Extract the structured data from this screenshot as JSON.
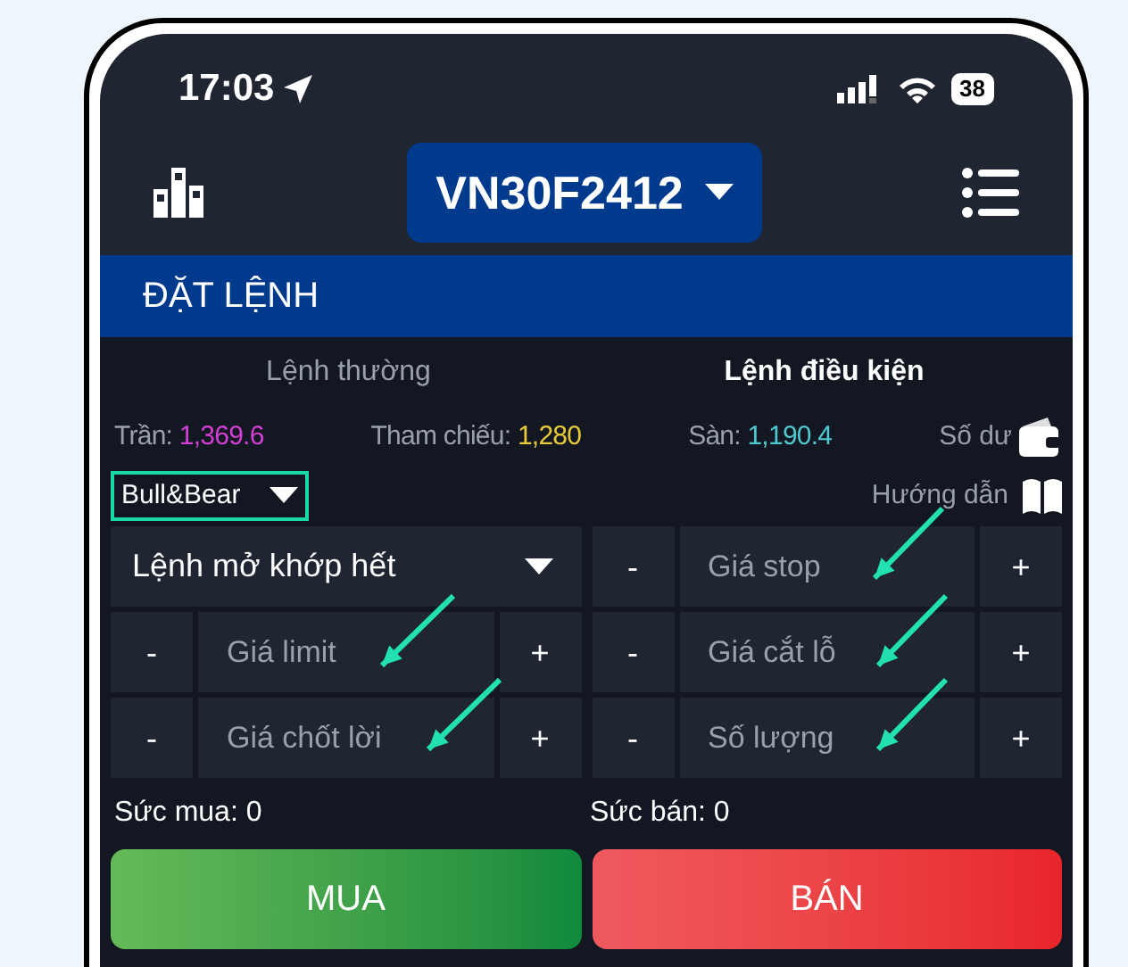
{
  "status_bar": {
    "time": "17:03",
    "battery": "38"
  },
  "header": {
    "symbol": "VN30F2412"
  },
  "title": "ĐẶT LỆNH",
  "tabs": [
    {
      "label": "Lệnh thường",
      "selected": false
    },
    {
      "label": "Lệnh điều kiện",
      "selected": true
    }
  ],
  "prices": [
    {
      "label": "Trần:",
      "value": "1,369.6",
      "color": "#d63fd6"
    },
    {
      "label": "Tham chiếu:",
      "value": "1,280",
      "color": "#e8c93a"
    },
    {
      "label": "Sàn:",
      "value": "1,190.4",
      "color": "#4fc9d0"
    }
  ],
  "balance_label": "Số dư",
  "strategy": {
    "value": "Bull&Bear"
  },
  "guide_label": "Hướng dẫn",
  "order_type": {
    "value": "Lệnh mở khớp hết"
  },
  "left_fields": [
    {
      "placeholder": "Giá limit",
      "minus": "-",
      "plus": "+"
    },
    {
      "placeholder": "Giá chốt lời",
      "minus": "-",
      "plus": "+"
    }
  ],
  "right_fields": [
    {
      "placeholder": "Giá stop",
      "minus": "-",
      "plus": "+"
    },
    {
      "placeholder": "Giá cắt lỗ",
      "minus": "-",
      "plus": "+"
    },
    {
      "placeholder": "Số lượng",
      "minus": "-",
      "plus": "+"
    }
  ],
  "power": [
    {
      "label": "Sức mua:",
      "value": "0"
    },
    {
      "label": "Sức bán:",
      "value": "0"
    }
  ],
  "actions": [
    {
      "label": "MUA",
      "kind": "buy"
    },
    {
      "label": "BÁN",
      "kind": "sell"
    }
  ]
}
